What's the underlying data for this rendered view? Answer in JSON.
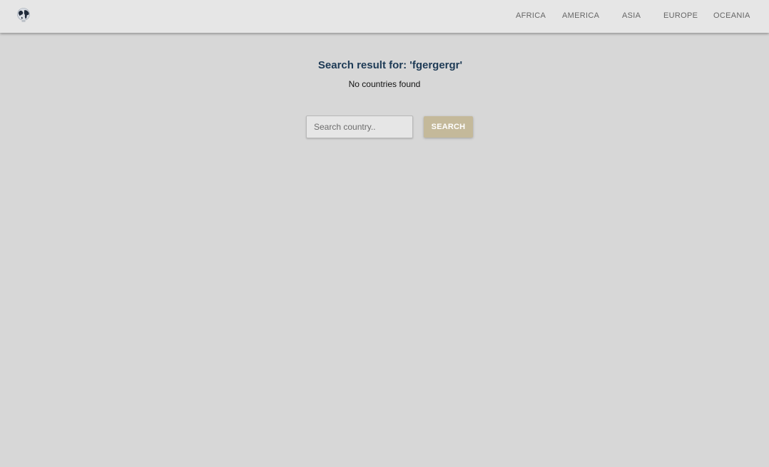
{
  "header": {
    "logo_icon": "globe-icon",
    "nav": [
      {
        "label": "AFRICA"
      },
      {
        "label": "AMERICA"
      },
      {
        "label": "ASIA"
      },
      {
        "label": "EUROPE"
      },
      {
        "label": "OCEANIA"
      }
    ]
  },
  "main": {
    "result_prefix": "Search result for: ",
    "query": "'fgergergr'",
    "no_results": "No countries found",
    "search": {
      "placeholder": "Search country..",
      "value": "",
      "button_label": "SEARCH"
    }
  },
  "colors": {
    "background": "#d7d7d7",
    "navbar": "#e6e6e6",
    "title": "#1d3a55",
    "button": "#c4b99a"
  }
}
